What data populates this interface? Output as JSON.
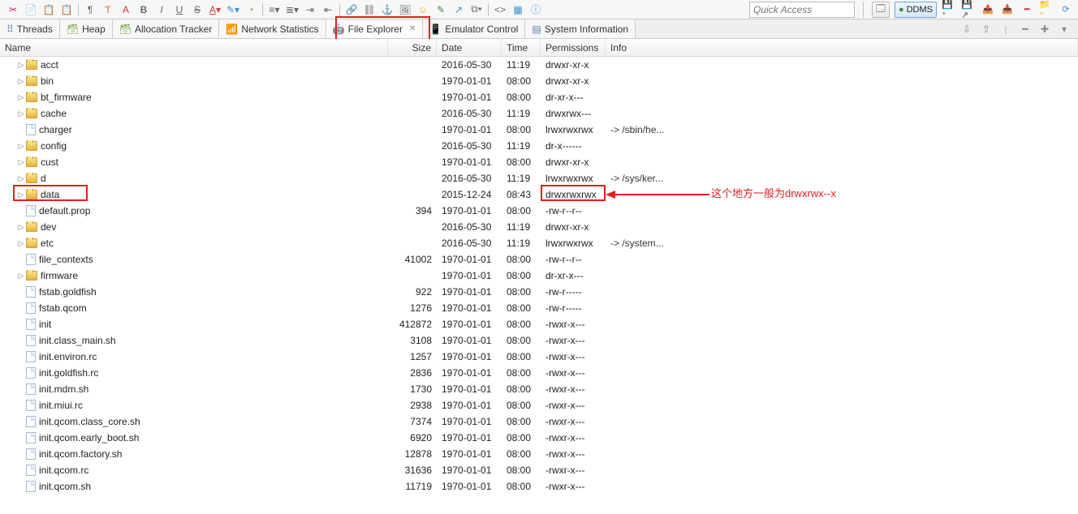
{
  "quick_access": {
    "placeholder": "Quick Access"
  },
  "perspective": {
    "label": "DDMS"
  },
  "tabs": [
    {
      "label": "Threads"
    },
    {
      "label": "Heap"
    },
    {
      "label": "Allocation Tracker"
    },
    {
      "label": "Network Statistics"
    },
    {
      "label": "File Explorer",
      "active": true,
      "closeable": true
    },
    {
      "label": "Emulator Control"
    },
    {
      "label": "System Information"
    }
  ],
  "columns": {
    "name": "Name",
    "size": "Size",
    "date": "Date",
    "time": "Time",
    "permissions": "Permissions",
    "info": "Info"
  },
  "rows": [
    {
      "depth": 1,
      "exp": true,
      "type": "folder",
      "name": "acct",
      "size": "",
      "date": "2016-05-30",
      "time": "11:19",
      "perm": "drwxr-xr-x",
      "info": ""
    },
    {
      "depth": 1,
      "exp": true,
      "type": "folder",
      "name": "bin",
      "size": "",
      "date": "1970-01-01",
      "time": "08:00",
      "perm": "drwxr-xr-x",
      "info": ""
    },
    {
      "depth": 1,
      "exp": true,
      "type": "folder",
      "name": "bt_firmware",
      "size": "",
      "date": "1970-01-01",
      "time": "08:00",
      "perm": "dr-xr-x---",
      "info": ""
    },
    {
      "depth": 1,
      "exp": false,
      "type": "folder",
      "name": "cache",
      "size": "",
      "date": "2016-05-30",
      "time": "11:19",
      "perm": "drwxrwx---",
      "info": ""
    },
    {
      "depth": 1,
      "exp": null,
      "type": "file",
      "name": "charger",
      "size": "",
      "date": "1970-01-01",
      "time": "08:00",
      "perm": "lrwxrwxrwx",
      "info": "-> /sbin/he..."
    },
    {
      "depth": 1,
      "exp": true,
      "type": "folder",
      "name": "config",
      "size": "",
      "date": "2016-05-30",
      "time": "11:19",
      "perm": "dr-x------",
      "info": ""
    },
    {
      "depth": 1,
      "exp": true,
      "type": "folder",
      "name": "cust",
      "size": "",
      "date": "1970-01-01",
      "time": "08:00",
      "perm": "drwxr-xr-x",
      "info": ""
    },
    {
      "depth": 1,
      "exp": false,
      "type": "folder",
      "name": "d",
      "size": "",
      "date": "2016-05-30",
      "time": "11:19",
      "perm": "lrwxrwxrwx",
      "info": "-> /sys/ker..."
    },
    {
      "depth": 1,
      "exp": true,
      "type": "folder",
      "name": "data",
      "size": "",
      "date": "2015-12-24",
      "time": "08:43",
      "perm": "drwxrwxrwx",
      "info": ""
    },
    {
      "depth": 1,
      "exp": null,
      "type": "file",
      "name": "default.prop",
      "size": "394",
      "date": "1970-01-01",
      "time": "08:00",
      "perm": "-rw-r--r--",
      "info": ""
    },
    {
      "depth": 1,
      "exp": true,
      "type": "folder",
      "name": "dev",
      "size": "",
      "date": "2016-05-30",
      "time": "11:19",
      "perm": "drwxr-xr-x",
      "info": ""
    },
    {
      "depth": 1,
      "exp": false,
      "type": "folder",
      "name": "etc",
      "size": "",
      "date": "2016-05-30",
      "time": "11:19",
      "perm": "lrwxrwxrwx",
      "info": "-> /system..."
    },
    {
      "depth": 1,
      "exp": null,
      "type": "file",
      "name": "file_contexts",
      "size": "41002",
      "date": "1970-01-01",
      "time": "08:00",
      "perm": "-rw-r--r--",
      "info": ""
    },
    {
      "depth": 1,
      "exp": true,
      "type": "folder",
      "name": "firmware",
      "size": "",
      "date": "1970-01-01",
      "time": "08:00",
      "perm": "dr-xr-x---",
      "info": ""
    },
    {
      "depth": 1,
      "exp": null,
      "type": "file",
      "name": "fstab.goldfish",
      "size": "922",
      "date": "1970-01-01",
      "time": "08:00",
      "perm": "-rw-r-----",
      "info": ""
    },
    {
      "depth": 1,
      "exp": null,
      "type": "file",
      "name": "fstab.qcom",
      "size": "1276",
      "date": "1970-01-01",
      "time": "08:00",
      "perm": "-rw-r-----",
      "info": ""
    },
    {
      "depth": 1,
      "exp": null,
      "type": "file",
      "name": "init",
      "size": "412872",
      "date": "1970-01-01",
      "time": "08:00",
      "perm": "-rwxr-x---",
      "info": ""
    },
    {
      "depth": 1,
      "exp": null,
      "type": "file",
      "name": "init.class_main.sh",
      "size": "3108",
      "date": "1970-01-01",
      "time": "08:00",
      "perm": "-rwxr-x---",
      "info": ""
    },
    {
      "depth": 1,
      "exp": null,
      "type": "file",
      "name": "init.environ.rc",
      "size": "1257",
      "date": "1970-01-01",
      "time": "08:00",
      "perm": "-rwxr-x---",
      "info": ""
    },
    {
      "depth": 1,
      "exp": null,
      "type": "file",
      "name": "init.goldfish.rc",
      "size": "2836",
      "date": "1970-01-01",
      "time": "08:00",
      "perm": "-rwxr-x---",
      "info": ""
    },
    {
      "depth": 1,
      "exp": null,
      "type": "file",
      "name": "init.mdm.sh",
      "size": "1730",
      "date": "1970-01-01",
      "time": "08:00",
      "perm": "-rwxr-x---",
      "info": ""
    },
    {
      "depth": 1,
      "exp": null,
      "type": "file",
      "name": "init.miui.rc",
      "size": "2938",
      "date": "1970-01-01",
      "time": "08:00",
      "perm": "-rwxr-x---",
      "info": ""
    },
    {
      "depth": 1,
      "exp": null,
      "type": "file",
      "name": "init.qcom.class_core.sh",
      "size": "7374",
      "date": "1970-01-01",
      "time": "08:00",
      "perm": "-rwxr-x---",
      "info": ""
    },
    {
      "depth": 1,
      "exp": null,
      "type": "file",
      "name": "init.qcom.early_boot.sh",
      "size": "6920",
      "date": "1970-01-01",
      "time": "08:00",
      "perm": "-rwxr-x---",
      "info": ""
    },
    {
      "depth": 1,
      "exp": null,
      "type": "file",
      "name": "init.qcom.factory.sh",
      "size": "12878",
      "date": "1970-01-01",
      "time": "08:00",
      "perm": "-rwxr-x---",
      "info": ""
    },
    {
      "depth": 1,
      "exp": null,
      "type": "file",
      "name": "init.qcom.rc",
      "size": "31636",
      "date": "1970-01-01",
      "time": "08:00",
      "perm": "-rwxr-x---",
      "info": ""
    },
    {
      "depth": 1,
      "exp": null,
      "type": "file",
      "name": "init.qcom.sh",
      "size": "11719",
      "date": "1970-01-01",
      "time": "08:00",
      "perm": "-rwxr-x---",
      "info": ""
    }
  ],
  "annotation": {
    "text": "这个地方一般为drwxrwx--x"
  }
}
